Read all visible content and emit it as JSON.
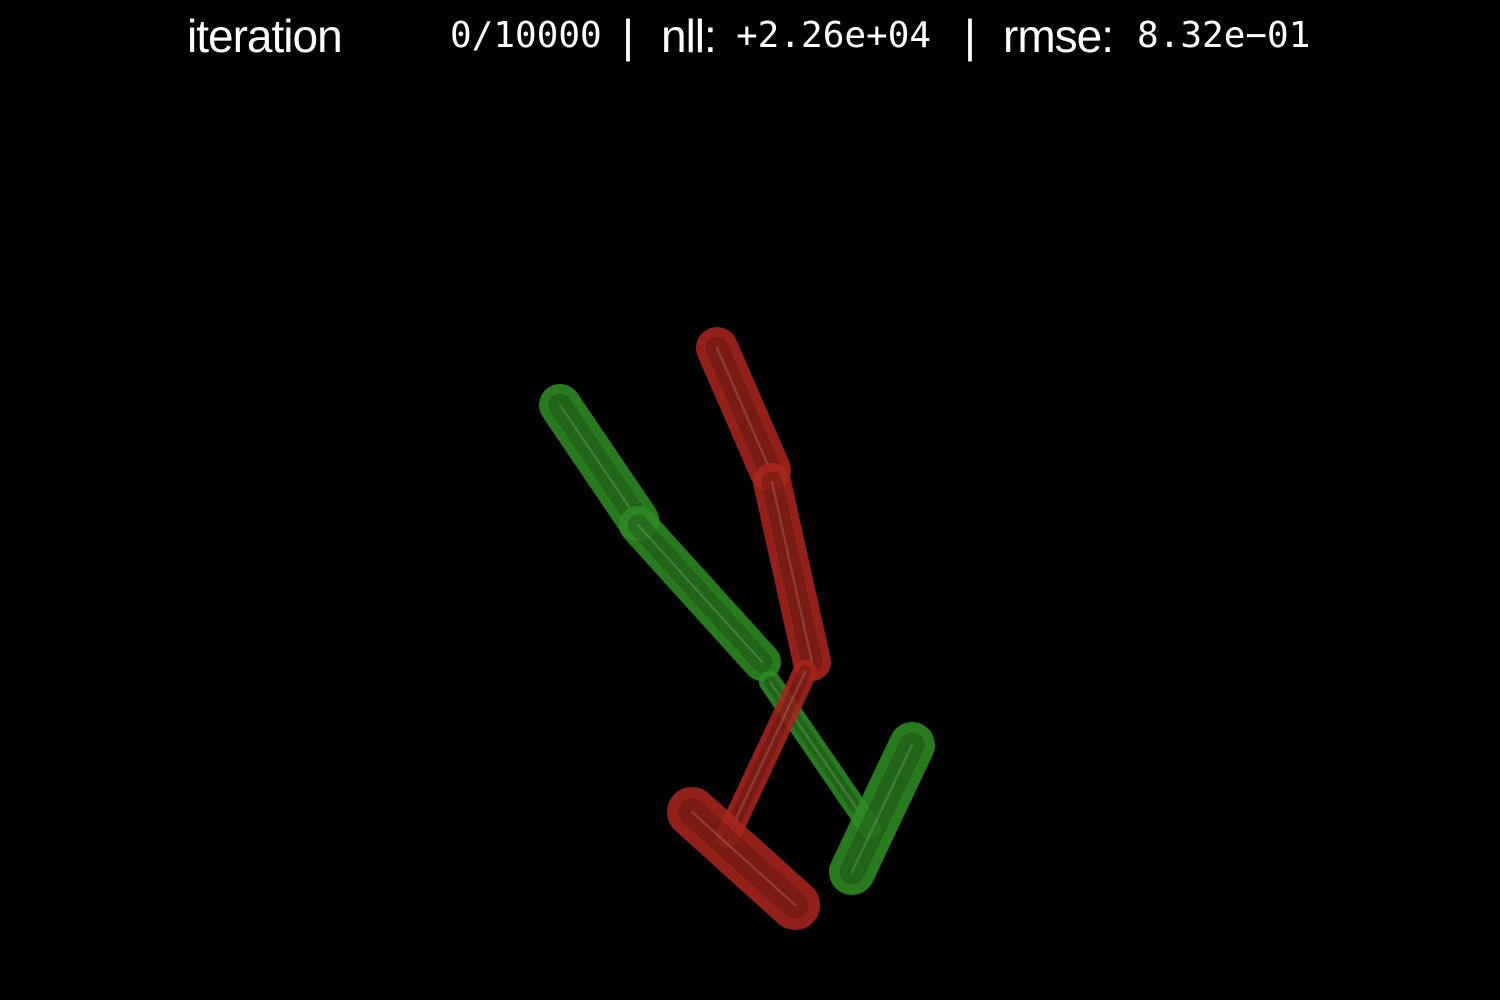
{
  "header": {
    "iteration_label": "iteration",
    "iteration_value": "0/10000",
    "sep1": "|",
    "nll_label": "nll:",
    "nll_value": "+2.26e+04",
    "sep2": "|",
    "rmse_label": "rmse:",
    "rmse_value": "8.32e−01"
  },
  "colors": {
    "background": "#000000",
    "text": "#ffffff",
    "green_series": "#2e8b22",
    "red_series": "#a8261c"
  }
}
